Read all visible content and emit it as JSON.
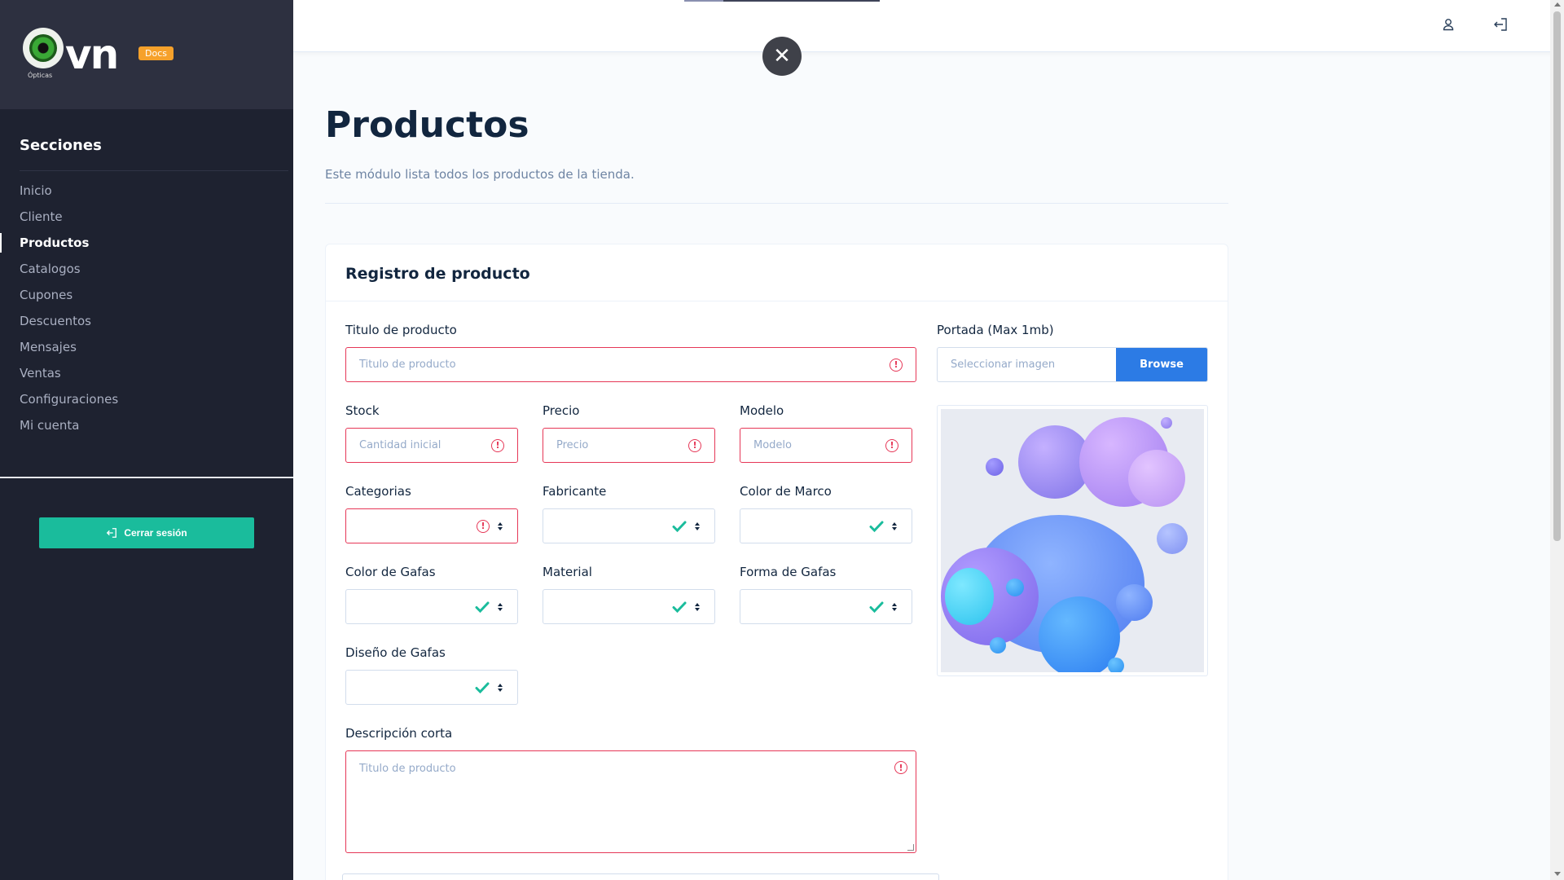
{
  "brand": {
    "logo_text": "vn",
    "logo_sub": "Ópticas",
    "docs_badge": "Docs"
  },
  "sidebar": {
    "sections_title": "Secciones",
    "items": [
      {
        "label": "Inicio",
        "active": false
      },
      {
        "label": "Cliente",
        "active": false
      },
      {
        "label": "Productos",
        "active": true
      },
      {
        "label": "Catalogos",
        "active": false
      },
      {
        "label": "Cupones",
        "active": false
      },
      {
        "label": "Descuentos",
        "active": false
      },
      {
        "label": "Mensajes",
        "active": false
      },
      {
        "label": "Ventas",
        "active": false
      },
      {
        "label": "Configuraciones",
        "active": false
      },
      {
        "label": "Mi cuenta",
        "active": false
      }
    ],
    "logout_label": "Cerrar sesión"
  },
  "topbar": {
    "icons": [
      "user-icon",
      "exit-icon"
    ],
    "close_icon": "close-icon"
  },
  "page": {
    "title": "Productos",
    "subtitle": "Este módulo lista todos los productos de la tienda."
  },
  "form": {
    "card_title": "Registro de producto",
    "titulo": {
      "label": "Titulo de producto",
      "placeholder": "Titulo de producto",
      "state": "invalid"
    },
    "portada": {
      "label": "Portada (Max 1mb)",
      "placeholder": "Seleccionar imagen",
      "button": "Browse"
    },
    "stock": {
      "label": "Stock",
      "placeholder": "Cantidad inicial",
      "state": "invalid"
    },
    "precio": {
      "label": "Precio",
      "placeholder": "Precio",
      "state": "invalid"
    },
    "modelo": {
      "label": "Modelo",
      "placeholder": "Modelo",
      "state": "invalid"
    },
    "categorias": {
      "label": "Categorias",
      "value": "",
      "state": "invalid"
    },
    "fabricante": {
      "label": "Fabricante",
      "value": "",
      "state": "valid"
    },
    "color_marco": {
      "label": "Color de Marco",
      "value": "",
      "state": "valid"
    },
    "color_gafas": {
      "label": "Color de Gafas",
      "value": "",
      "state": "valid"
    },
    "material": {
      "label": "Material",
      "value": "",
      "state": "valid"
    },
    "forma_gafas": {
      "label": "Forma de Gafas",
      "value": "",
      "state": "valid"
    },
    "diseno_gafas": {
      "label": "Diseño de Gafas",
      "value": "",
      "state": "valid"
    },
    "descripcion": {
      "label": "Descripción corta",
      "placeholder": "Titulo de producto",
      "state": "invalid"
    }
  },
  "colors": {
    "sidebar_bg": "#1e2230",
    "accent_green": "#1abc9c",
    "error_red": "#e63757",
    "primary_blue": "#2c7be5",
    "docs_orange": "#f6a12b"
  }
}
